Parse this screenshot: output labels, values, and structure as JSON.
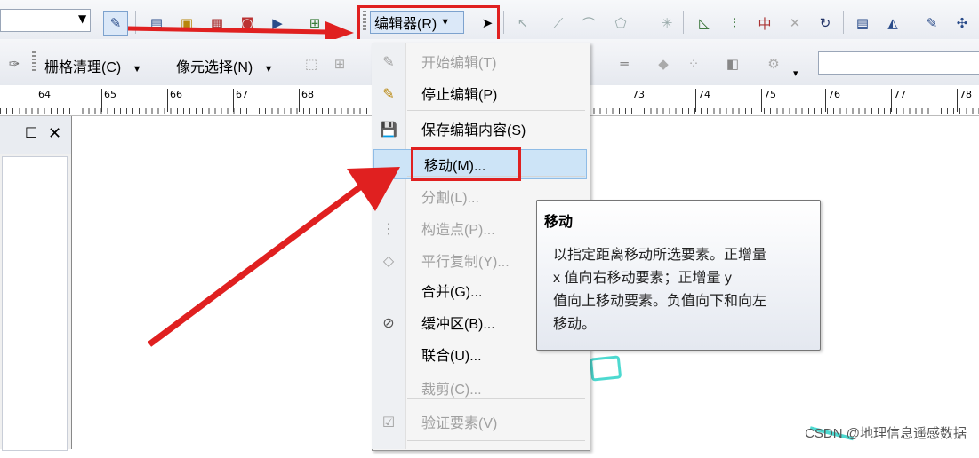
{
  "colors": {
    "accent_red": "#e02020",
    "menu_highlight": "#cde4f7",
    "shape_cyan": "#4dd9d0"
  },
  "toolbar1": {
    "editor_menu_label": "编辑器(R)",
    "dropdown_arrow": "▾",
    "icons": [
      "edit-tool-icon",
      "table-icon",
      "layout-icon",
      "catalog-icon",
      "toolbox-icon",
      "python-icon",
      "model-icon"
    ]
  },
  "toolbar2": {
    "raster_cleanup_label": "栅格清理(C)",
    "pixel_select_label": "像元选择(N)"
  },
  "ruler": {
    "ticks": [
      "64",
      "65",
      "66",
      "67",
      "68",
      "73",
      "74",
      "75",
      "76",
      "77",
      "78"
    ]
  },
  "menu": {
    "items": [
      {
        "label": "开始编辑(T)",
        "icon": "pencil-icon",
        "enabled": false
      },
      {
        "label": "停止编辑(P)",
        "icon": "pencil-stop-icon",
        "enabled": true
      },
      {
        "label": "保存编辑内容(S)",
        "icon": "save-edits-icon",
        "enabled": true
      },
      {
        "label": "移动(M)...",
        "icon": "",
        "enabled": true,
        "highlighted": true
      },
      {
        "label": "分割(L)...",
        "icon": "",
        "enabled": false
      },
      {
        "label": "构造点(P)...",
        "icon": "construct-points-icon",
        "enabled": false
      },
      {
        "label": "平行复制(Y)...",
        "icon": "copy-parallel-icon",
        "enabled": false
      },
      {
        "label": "合并(G)...",
        "icon": "",
        "enabled": true
      },
      {
        "label": "缓冲区(B)...",
        "icon": "buffer-icon",
        "enabled": true
      },
      {
        "label": "联合(U)...",
        "icon": "",
        "enabled": true
      },
      {
        "label": "裁剪(C)...",
        "icon": "",
        "enabled": false
      },
      {
        "label": "验证要素(V)",
        "icon": "validate-icon",
        "enabled": false
      }
    ]
  },
  "tooltip": {
    "title": "移动",
    "body": "以指定距离移动所选要素。正增量\nx 值向右移动要素；正增量 y\n值向上移动要素。负值向下和向左\n移动。"
  },
  "watermark": "CSDN @地理信息遥感数据"
}
